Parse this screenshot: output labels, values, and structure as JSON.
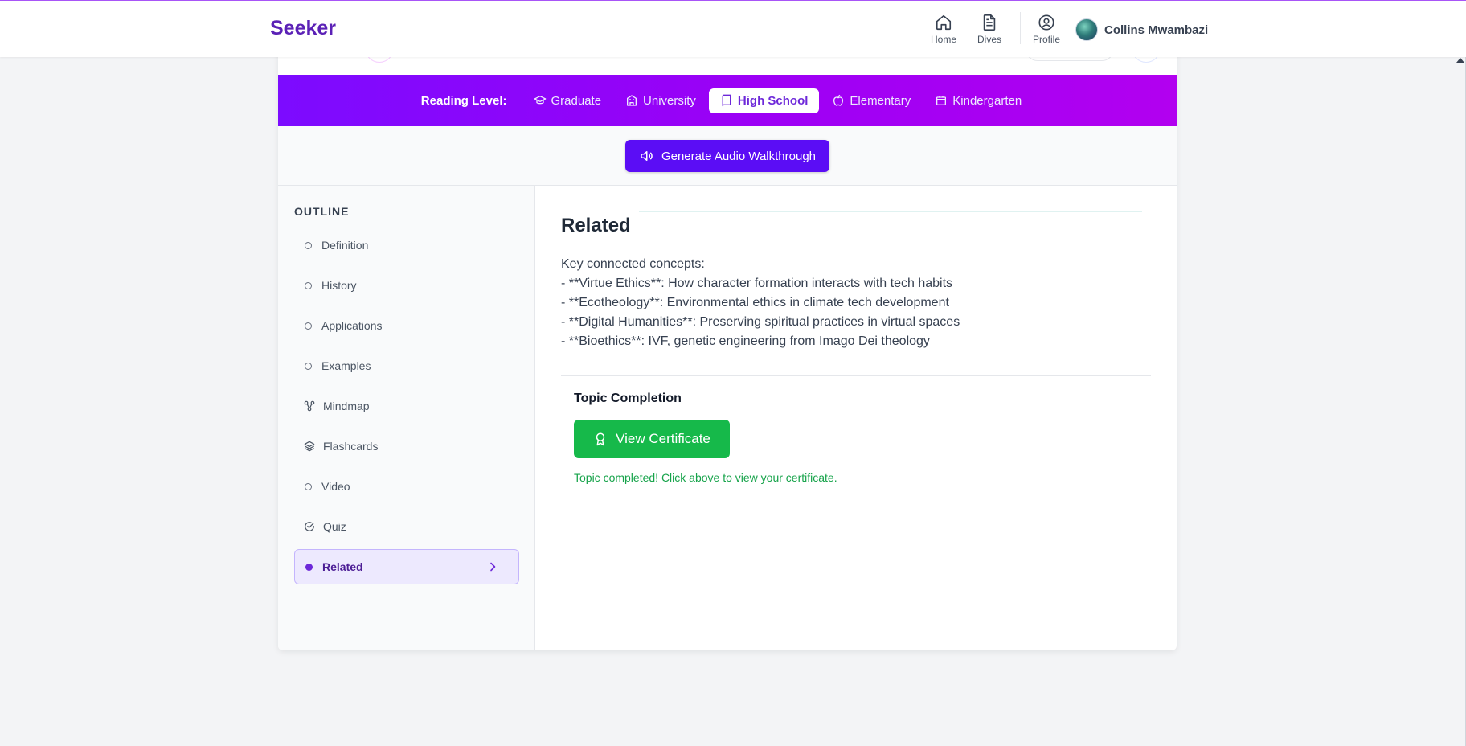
{
  "app": {
    "brand": "Seeker"
  },
  "nav": {
    "items": [
      {
        "label": "Home",
        "icon": "home-icon"
      },
      {
        "label": "Dives",
        "icon": "document-icon"
      },
      {
        "label": "Profile",
        "icon": "user-circle-icon"
      }
    ],
    "user_name": "Collins Mwambazi"
  },
  "reading_level": {
    "label": "Reading Level:",
    "options": [
      {
        "label": "Graduate",
        "icon": "graduation-cap-icon"
      },
      {
        "label": "University",
        "icon": "building-icon"
      },
      {
        "label": "High School",
        "icon": "book-icon",
        "selected": true
      },
      {
        "label": "Elementary",
        "icon": "apple-icon"
      },
      {
        "label": "Kindergarten",
        "icon": "calendar-icon"
      }
    ]
  },
  "audio": {
    "button_label": "Generate Audio Walkthrough",
    "icon": "speaker-icon"
  },
  "outline": {
    "title": "OUTLINE",
    "items": [
      {
        "label": "Definition",
        "icon": "circle-icon"
      },
      {
        "label": "History",
        "icon": "circle-icon"
      },
      {
        "label": "Applications",
        "icon": "circle-icon"
      },
      {
        "label": "Examples",
        "icon": "circle-icon"
      },
      {
        "label": "Mindmap",
        "icon": "mindmap-icon"
      },
      {
        "label": "Flashcards",
        "icon": "layers-icon"
      },
      {
        "label": "Video",
        "icon": "circle-icon"
      },
      {
        "label": "Quiz",
        "icon": "check-circle-icon"
      },
      {
        "label": "Related",
        "icon": "filled-circle-icon",
        "active": true
      }
    ]
  },
  "content": {
    "title": "Related",
    "lines": [
      "Key connected concepts:",
      "- **Virtue Ethics**: How character formation interacts with tech habits",
      "- **Ecotheology**: Environmental ethics in climate tech development",
      "- **Digital Humanities**: Preserving spiritual practices in virtual spaces",
      "- **Bioethics**: IVF, genetic engineering from Imago Dei theology"
    ]
  },
  "completion": {
    "title": "Topic Completion",
    "button_label": "View Certificate",
    "button_icon": "award-icon",
    "note": "Topic completed! Click above to view your certificate."
  },
  "colors": {
    "brand": "#5b21b6",
    "accent_gradient_start": "#7c0bff",
    "accent_gradient_end": "#b200f0",
    "primary_button": "#5b0df5",
    "success": "#16b94a"
  }
}
